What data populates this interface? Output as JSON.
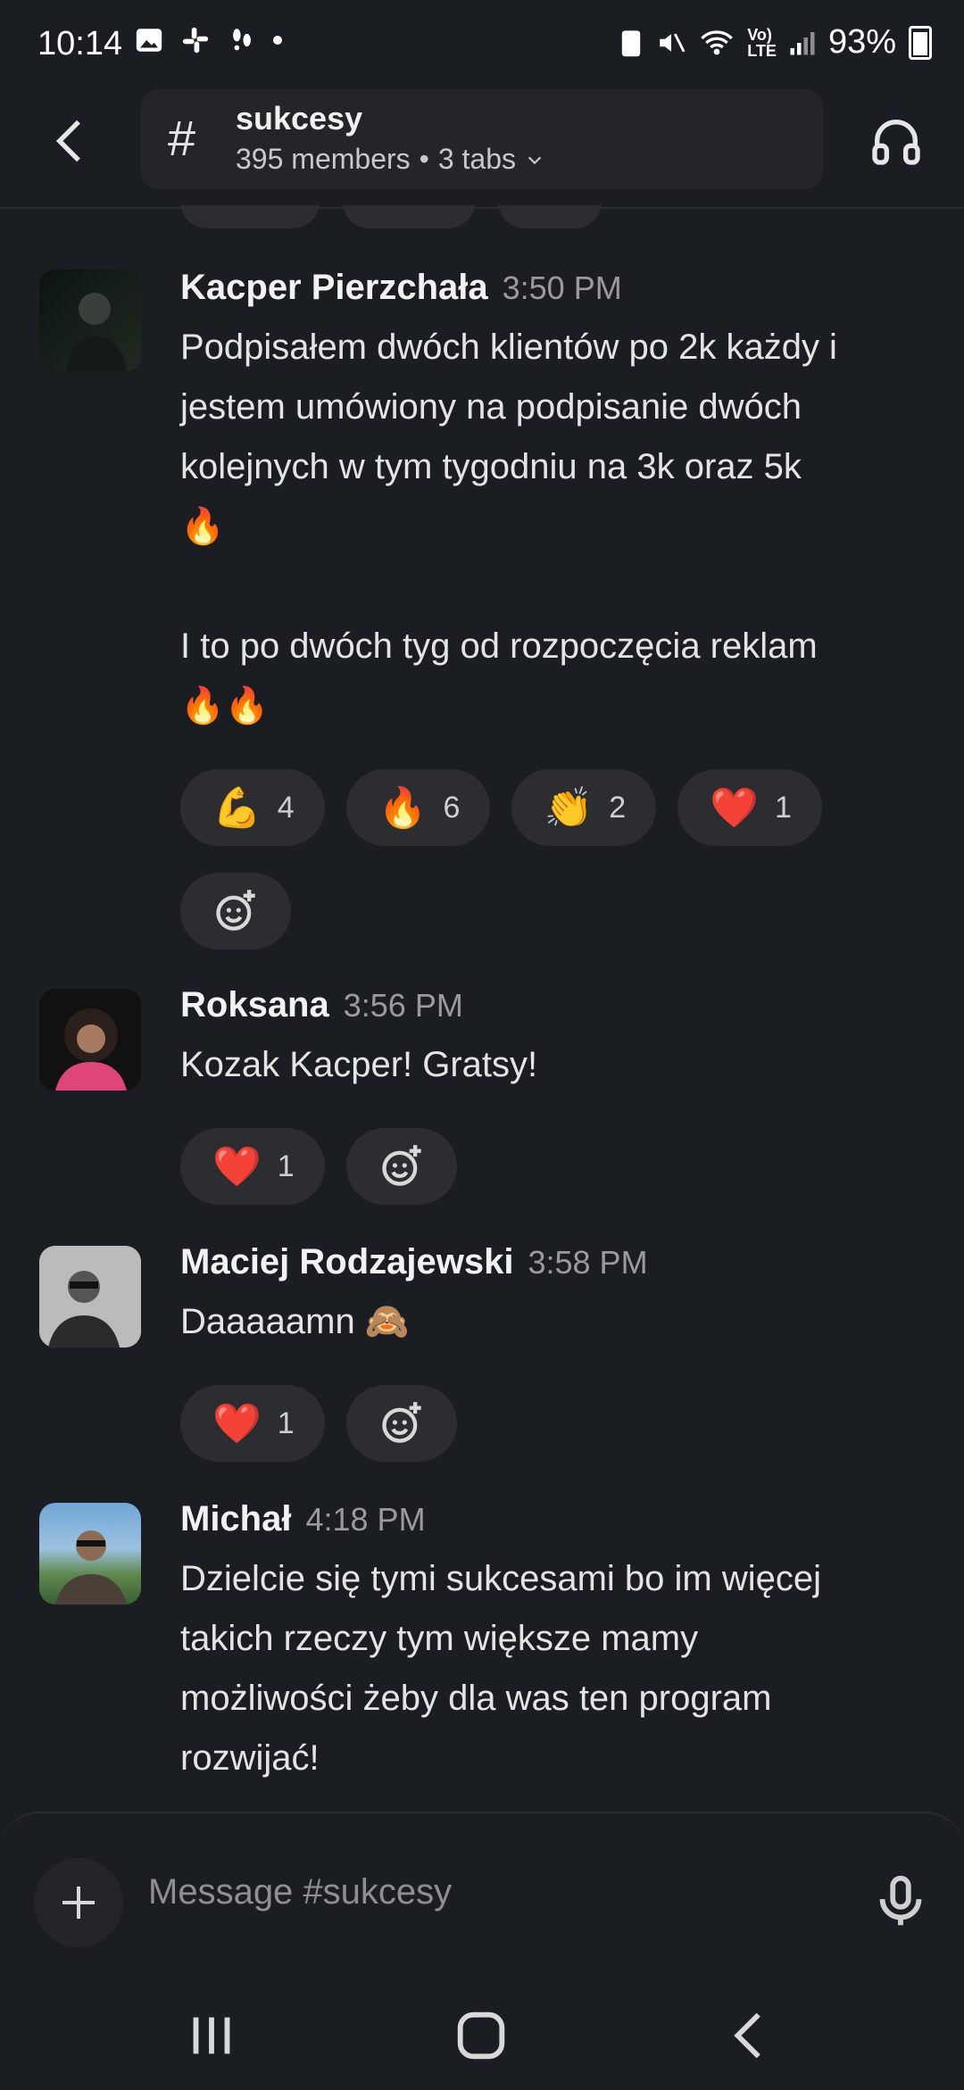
{
  "status_bar": {
    "time": "10:14",
    "battery": "93%"
  },
  "header": {
    "channel_name": "sukcesy",
    "members": "395 members",
    "separator": "•",
    "tabs": "3 tabs",
    "hash": "#"
  },
  "messages": [
    {
      "author": "Kacper Pierzchała",
      "time": "3:50 PM",
      "lines": [
        "Podpisałem dwóch klientów po 2k każdy i",
        "jestem umówiony na podpisanie dwóch",
        "kolejnych w tym tygodniu na 3k oraz 5k",
        "🔥",
        "",
        "I to po dwóch tyg od rozpoczęcia reklam",
        "🔥🔥"
      ],
      "reactions": [
        {
          "emoji": "💪",
          "count": "4"
        },
        {
          "emoji": "🔥",
          "count": "6"
        },
        {
          "emoji": "👏",
          "count": "2"
        },
        {
          "emoji": "❤️",
          "count": "1"
        }
      ]
    },
    {
      "author": "Roksana",
      "time": "3:56 PM",
      "lines": [
        "Kozak Kacper! Gratsy!"
      ],
      "reactions": [
        {
          "emoji": "❤️",
          "count": "1"
        }
      ]
    },
    {
      "author": "Maciej Rodzajewski",
      "time": "3:58 PM",
      "lines": [
        "Daaaaamn 🙈"
      ],
      "reactions": [
        {
          "emoji": "❤️",
          "count": "1"
        }
      ]
    },
    {
      "author": "Michał",
      "time": "4:18 PM",
      "lines": [
        "Dzielcie się tymi sukcesami bo im więcej",
        "takich rzeczy tym większe mamy",
        "możliwości żeby dla was ten program",
        "rozwijać!"
      ]
    }
  ],
  "composer": {
    "placeholder": "Message #sukcesy"
  },
  "colors": {
    "background": "#1a1d21",
    "pill": "#2b2d31",
    "text": "#e4e4e4",
    "muted": "#9a9b9e"
  }
}
